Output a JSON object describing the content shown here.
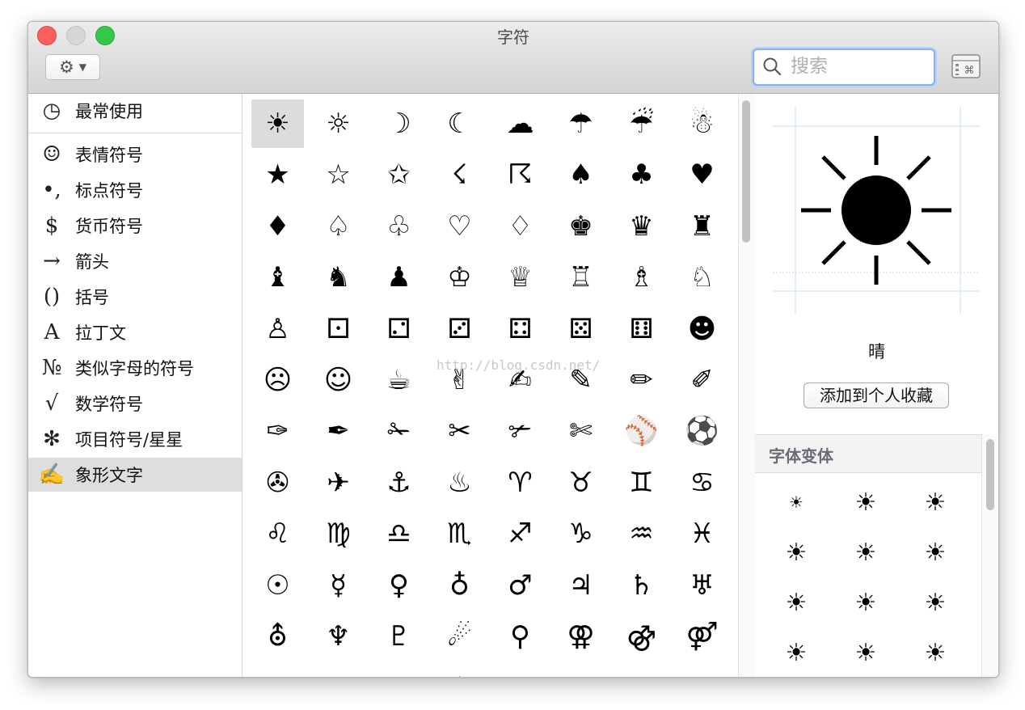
{
  "window": {
    "title": "字符"
  },
  "search": {
    "placeholder": "搜索",
    "value": ""
  },
  "sidebar": {
    "items": [
      {
        "icon": "◷",
        "icon_name": "clock-icon",
        "label": "最常使用",
        "name": "sidebar-item-frequent"
      },
      {
        "icon": "☺",
        "icon_name": "smiley-icon",
        "label": "表情符号",
        "name": "sidebar-item-emoji"
      },
      {
        "icon": "•,",
        "icon_name": "punctuation-icon",
        "label": "标点符号",
        "name": "sidebar-item-punctuation"
      },
      {
        "icon": "$",
        "icon_name": "dollar-icon",
        "label": "货币符号",
        "name": "sidebar-item-currency"
      },
      {
        "icon": "→",
        "icon_name": "arrow-icon",
        "label": "箭头",
        "name": "sidebar-item-arrows"
      },
      {
        "icon": "()",
        "icon_name": "parentheses-icon",
        "label": "括号",
        "name": "sidebar-item-brackets"
      },
      {
        "icon": "A",
        "icon_name": "letter-a-icon",
        "label": "拉丁文",
        "name": "sidebar-item-latin"
      },
      {
        "icon": "№",
        "icon_name": "numero-icon",
        "label": "类似字母的符号",
        "name": "sidebar-item-letterlike"
      },
      {
        "icon": "√",
        "icon_name": "sqrt-icon",
        "label": "数学符号",
        "name": "sidebar-item-math"
      },
      {
        "icon": "✻",
        "icon_name": "asterisk-icon",
        "label": "项目符号/星星",
        "name": "sidebar-item-bullets-stars"
      },
      {
        "icon": "✍",
        "icon_name": "writing-hand-icon",
        "label": "象形文字",
        "name": "sidebar-item-pictographs",
        "selected": true
      }
    ]
  },
  "grid": {
    "rows": [
      [
        "☀",
        "☼",
        "☽",
        "☾",
        "☁",
        "☂",
        "☔",
        "☃"
      ],
      [
        "★",
        "☆",
        "✩",
        "☇",
        "☈",
        "♠",
        "♣",
        "♥"
      ],
      [
        "♦",
        "♤",
        "♧",
        "♡",
        "♢",
        "♚",
        "♛",
        "♜"
      ],
      [
        "♝",
        "♞",
        "♟",
        "♔",
        "♕",
        "♖",
        "♗",
        "♘"
      ],
      [
        "♙",
        "⚀",
        "⚁",
        "⚂",
        "⚃",
        "⚄",
        "⚅",
        "☻"
      ],
      [
        "☹",
        "☺",
        "☕",
        "✌",
        "✍",
        "✎",
        "✏",
        "✐"
      ],
      [
        "✑",
        "✒",
        "✁",
        "✂",
        "✃",
        "✄",
        "⚾",
        "⚽"
      ],
      [
        "✇",
        "✈",
        "⚓",
        "♨",
        "♈",
        "♉",
        "♊",
        "♋"
      ],
      [
        "♌",
        "♍",
        "♎",
        "♏",
        "♐",
        "♑",
        "♒",
        "♓"
      ],
      [
        "☉",
        "☿",
        "♀",
        "♁",
        "♂",
        "♃",
        "♄",
        "♅"
      ],
      [
        "⛢",
        "♆",
        "♇",
        "☄",
        "⚲",
        "⚢",
        "⚣",
        "⚤"
      ],
      [
        "",
        "",
        "",
        "♦",
        "",
        "",
        "",
        ""
      ]
    ]
  },
  "detail": {
    "char": "☀",
    "name": "晴",
    "add_favorite_label": "添加到个人收藏",
    "variants_title": "字体变体",
    "variants": [
      "☀",
      "☀",
      "☀",
      "☀",
      "☀",
      "☀",
      "☀",
      "☀",
      "☀",
      "☀",
      "☀",
      "☀"
    ]
  },
  "watermark": "http://blog.csdn.net/"
}
